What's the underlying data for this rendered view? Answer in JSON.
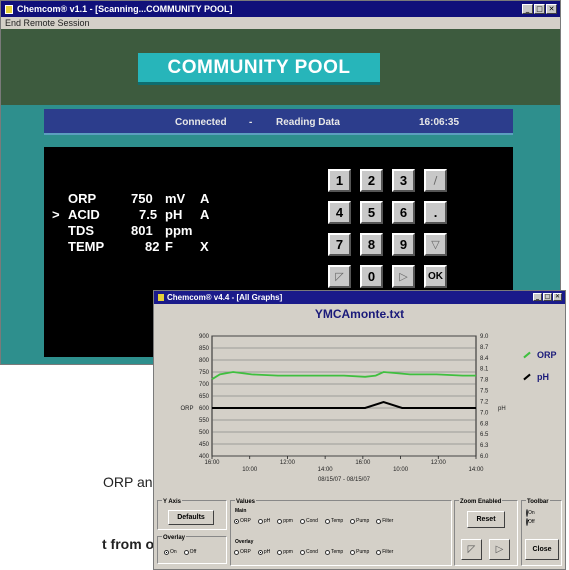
{
  "window1": {
    "title": "Chemcom® v1.1 - [Scanning...COMMUNITY POOL]",
    "menu": "End Remote Session",
    "banner": "COMMUNITY POOL",
    "status": {
      "connection": "Connected",
      "separator": "-",
      "activity": "Reading Data",
      "time": "16:06:35"
    },
    "readings": [
      {
        "marker": "",
        "name": "ORP",
        "value": "750",
        "unit": "mV",
        "mode": "A"
      },
      {
        "marker": ">",
        "name": "ACID",
        "value": "7.5",
        "unit": "pH",
        "mode": "A"
      },
      {
        "marker": "",
        "name": "TDS",
        "value": "801",
        "unit": "ppm",
        "mode": ""
      },
      {
        "marker": "",
        "name": "TEMP",
        "value": "82",
        "unit": "F",
        "mode": "X"
      }
    ],
    "keypad": [
      "1",
      "2",
      "3",
      "/",
      "4",
      "5",
      "6",
      ".",
      "7",
      "8",
      "9",
      "▽",
      "◸",
      "0",
      "▷",
      "OK"
    ]
  },
  "window2": {
    "title": "Chemcom® v4.4 - [All Graphs]",
    "chart_title": "YMCAmonte.txt",
    "left_axis_label": "ORP",
    "right_axis_label": "pH",
    "legend": [
      {
        "name": "ORP",
        "color": "#3fbf3f"
      },
      {
        "name": "pH",
        "color": "#000000"
      }
    ],
    "date_range": "08/15/07 - 08/15/07",
    "groups": {
      "y_axis": {
        "label": "Y Axis",
        "button": "Defaults"
      },
      "overlay": {
        "label": "Overlay",
        "options": [
          "On",
          "Off"
        ],
        "selected": "On"
      },
      "values": {
        "label": "Values",
        "main_label": "Main",
        "main_options": [
          "ORP",
          "pH",
          "ppm",
          "Cond",
          "Temp",
          "Pump",
          "Filter"
        ],
        "main_selected": "ORP",
        "overlay_label": "Overlay",
        "overlay_options": [
          "ORP",
          "pH",
          "ppm",
          "Cond",
          "Temp",
          "Pump",
          "Filter"
        ],
        "overlay_selected": "pH"
      },
      "zoom": {
        "label": "Zoom Enabled",
        "button": "Reset"
      },
      "toolbar": {
        "label": "Toolbar",
        "options": [
          "On",
          "Off"
        ],
        "selected": "Off",
        "close": "Close"
      }
    }
  },
  "chart_data": {
    "type": "line",
    "title": "YMCAmonte.txt",
    "xlabel": "08/15/07 - 08/15/07",
    "x_ticks": [
      "16:00",
      "10:00",
      "12:00",
      "14:00",
      "16:00",
      "10:00",
      "12:00",
      "14:00"
    ],
    "y_left": {
      "label": "ORP",
      "ticks": [
        400,
        450,
        500,
        550,
        600,
        650,
        700,
        750,
        800,
        850,
        900
      ],
      "range": [
        400,
        900
      ]
    },
    "y_right": {
      "label": "pH",
      "ticks": [
        6.0,
        6.3,
        6.5,
        6.8,
        7.0,
        7.2,
        7.5,
        7.8,
        8.1,
        8.4,
        8.7,
        9.0
      ],
      "range": [
        6.0,
        9.0
      ]
    },
    "series": [
      {
        "name": "ORP",
        "axis": "left",
        "color": "#3fbf3f",
        "x": [
          0,
          0.03,
          0.08,
          0.15,
          0.25,
          0.4,
          0.5,
          0.58,
          0.62,
          0.65,
          0.75,
          0.85,
          0.95,
          1.0
        ],
        "values": [
          720,
          740,
          750,
          740,
          735,
          735,
          735,
          730,
          735,
          750,
          740,
          740,
          735,
          735
        ]
      },
      {
        "name": "pH",
        "axis": "left",
        "color": "#000000",
        "x": [
          0,
          0.4,
          0.58,
          0.65,
          0.72,
          0.8,
          1.0
        ],
        "values": [
          600,
          600,
          600,
          625,
          600,
          600,
          600
        ]
      }
    ],
    "grid": true
  },
  "captions": [
    "ORP and",
    "t from our"
  ]
}
